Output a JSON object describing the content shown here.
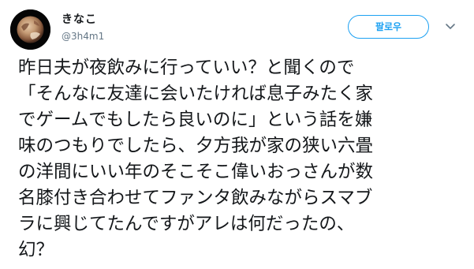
{
  "user": {
    "display_name": "きなこ",
    "handle": "@3h4m1",
    "avatar_icon": "dwarf-planet-avatar-icon"
  },
  "actions": {
    "follow_label": "팔로우",
    "more_icon": "chevron-down-icon"
  },
  "tweet": {
    "lines": [
      "昨日夫が夜飲みに行っていい？と聞くので",
      "「そんなに友達に会いたければ息子みたく家",
      "でゲームでもしたら良いのに」という話を嫌",
      "味のつもりでしたら、夕方我が家の狭い六畳",
      "の洋間にいい年のそこそこ偉いおっさんが数",
      "名膝付き合わせてファンタ飲みながらスマブ",
      "ラに興じてたんですがアレは何だったの、",
      "幻？"
    ]
  },
  "colors": {
    "accent": "#1da1f2",
    "text": "#14171a",
    "muted": "#657786"
  }
}
